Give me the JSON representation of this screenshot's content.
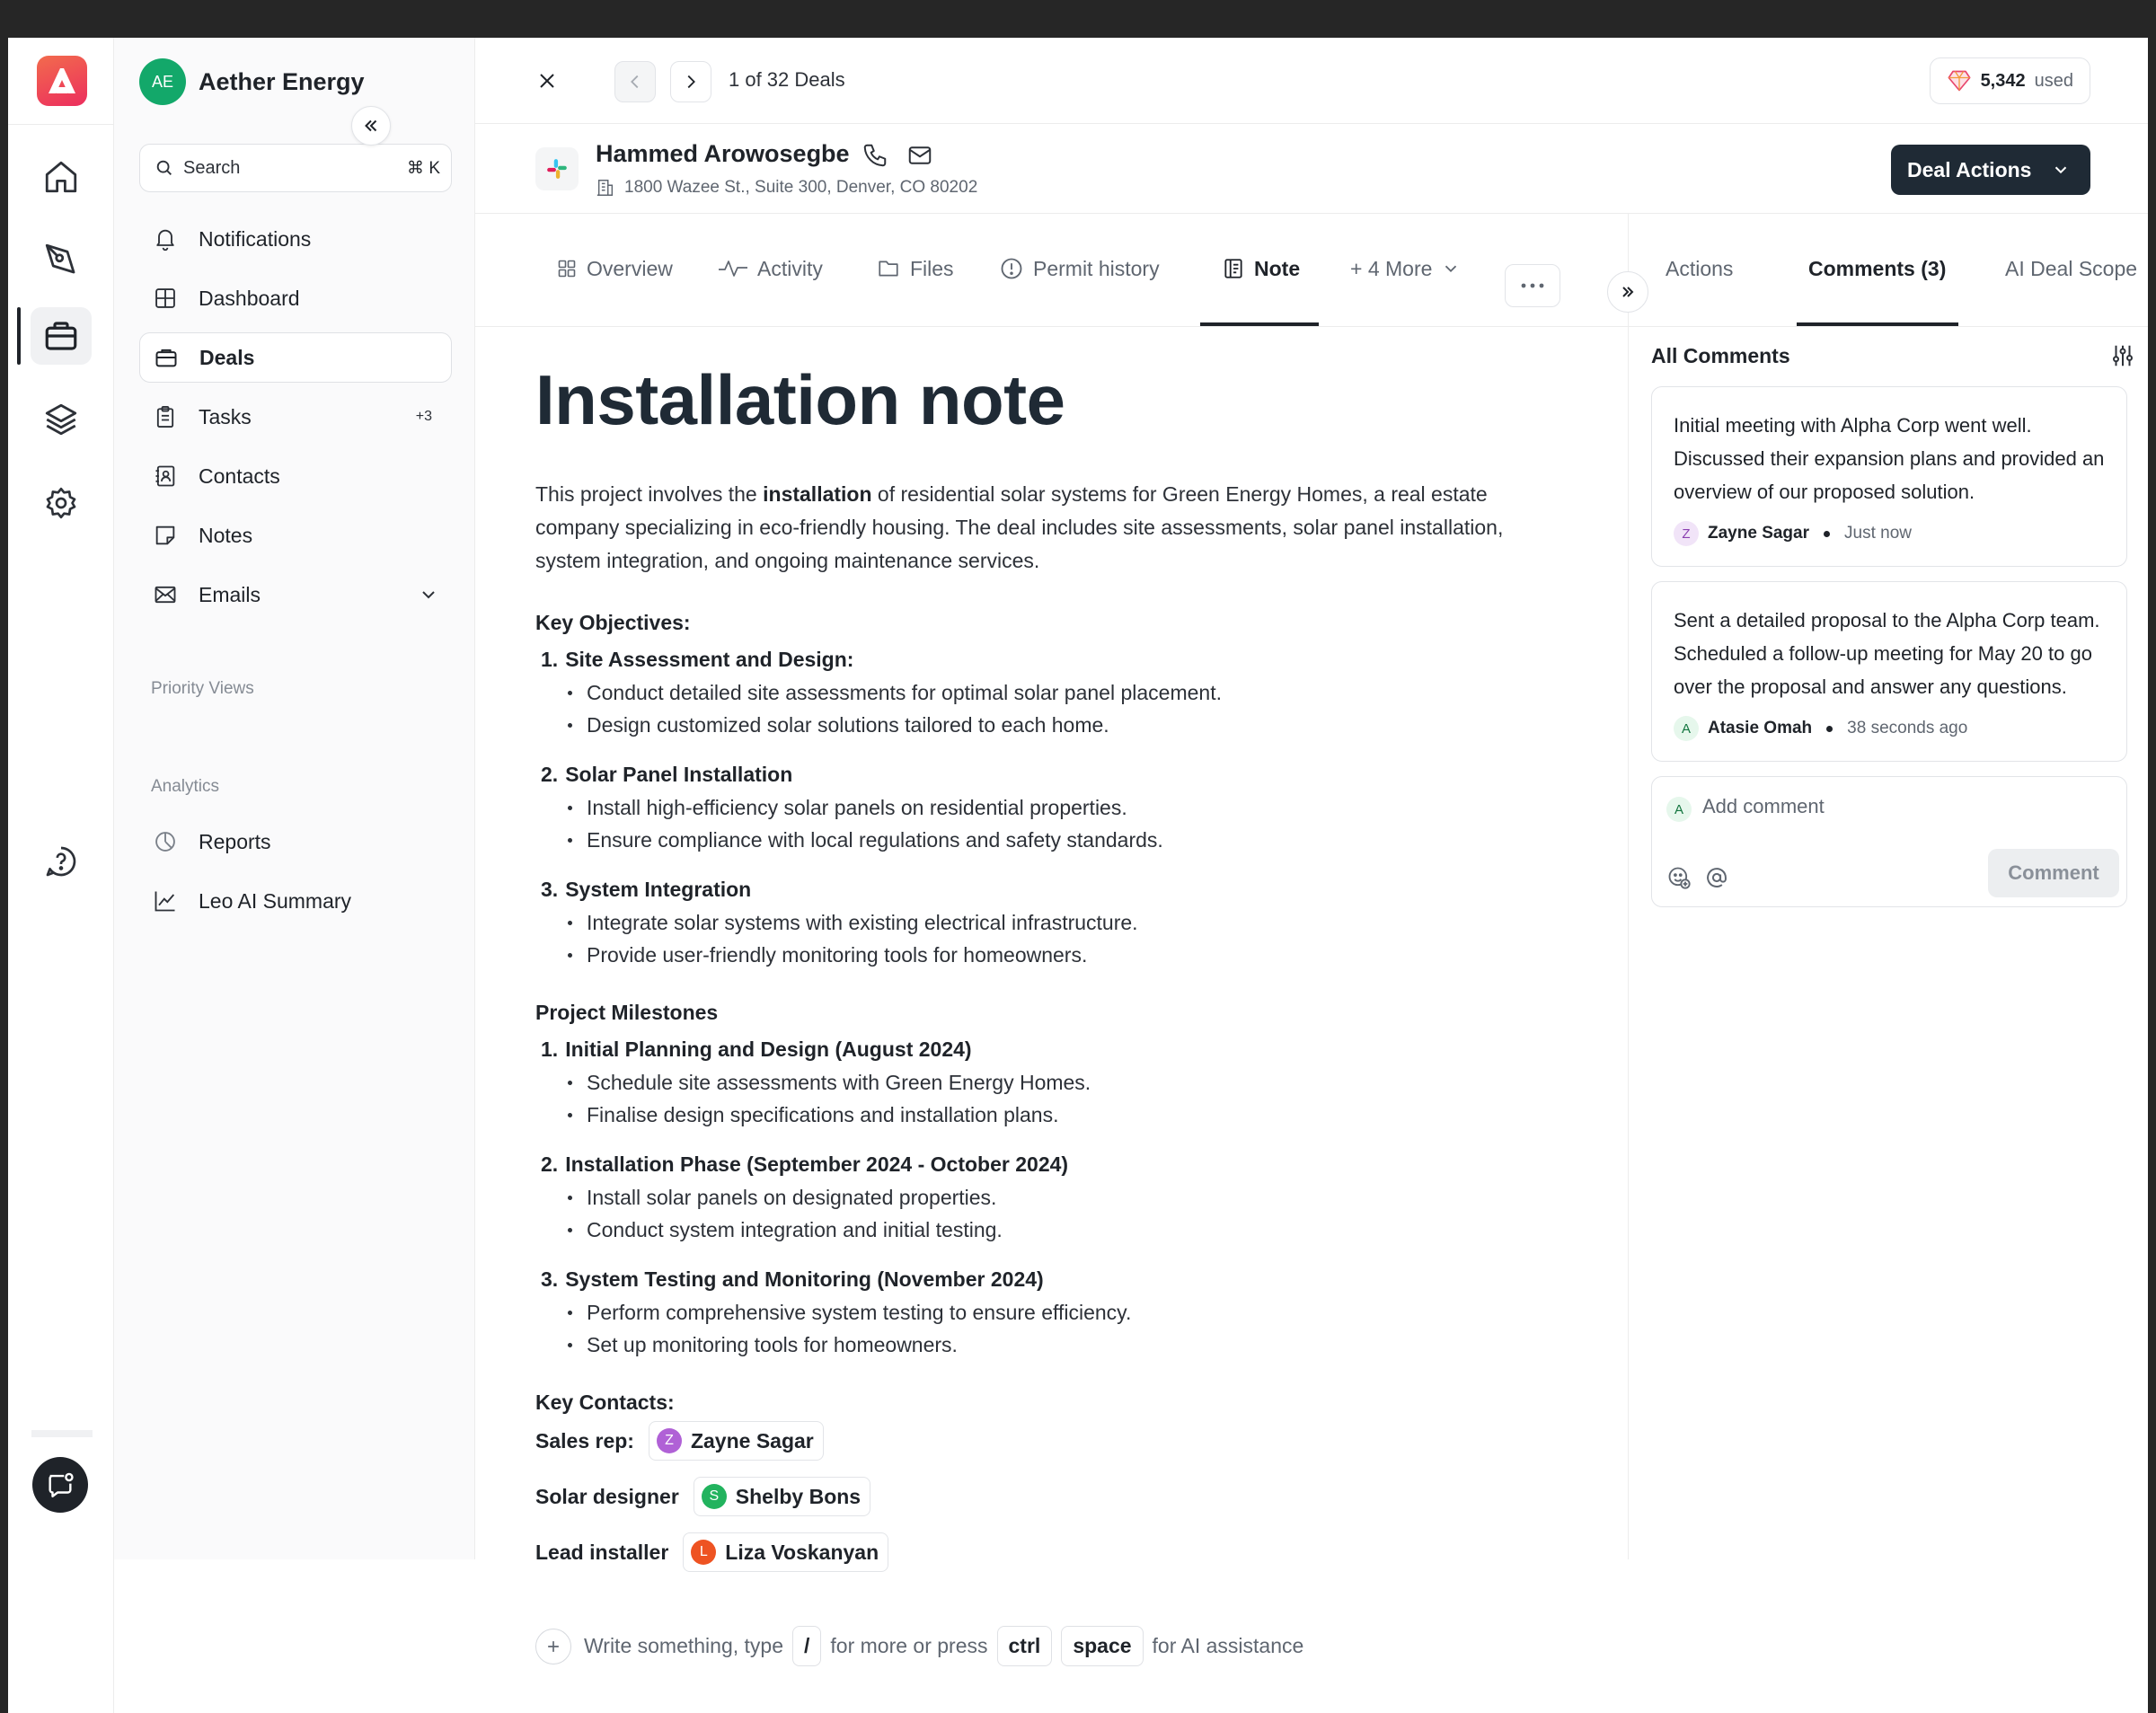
{
  "workspace": {
    "initials": "AE",
    "name": "Aether Energy"
  },
  "search": {
    "placeholder": "Search",
    "shortcut": "⌘ K"
  },
  "sidebar": {
    "items": [
      {
        "label": "Notifications",
        "icon": "bell-icon"
      },
      {
        "label": "Dashboard",
        "icon": "grid-icon"
      },
      {
        "label": "Deals",
        "icon": "briefcase-icon"
      },
      {
        "label": "Tasks",
        "icon": "clipboard-icon",
        "badge": "+3"
      },
      {
        "label": "Contacts",
        "icon": "contact-book-icon"
      },
      {
        "label": "Notes",
        "icon": "note-icon"
      },
      {
        "label": "Emails",
        "icon": "mail-icon"
      }
    ],
    "priority_label": "Priority Views",
    "analytics_label": "Analytics",
    "analytics_items": [
      {
        "label": "Reports",
        "icon": "pie-chart-icon"
      },
      {
        "label": "Leo AI Summary",
        "icon": "trend-line-icon"
      }
    ]
  },
  "topbar": {
    "pager_text": "1 of 32 Deals",
    "usage_value": "5,342",
    "usage_suffix": "used"
  },
  "contact": {
    "name": "Hammed Arowosegbe",
    "address": "1800 Wazee St., Suite 300, Denver, CO 80202",
    "deal_actions_label": "Deal Actions"
  },
  "tabs": {
    "overview": "Overview",
    "activity": "Activity",
    "files": "Files",
    "permit": "Permit history",
    "note": "Note",
    "more": "+ 4 More"
  },
  "right_tabs": {
    "actions": "Actions",
    "comments": "Comments (3)",
    "ai_scope": "AI Deal Scope"
  },
  "note": {
    "title": "Installation note",
    "intro_before": "This project involves the ",
    "intro_bold": "installation",
    "intro_after": " of residential solar systems for Green Energy Homes, a real estate company specializing in eco-friendly housing. The deal includes site assessments, solar panel installation, system integration, and ongoing maintenance services.",
    "objectives_heading": "Key Objectives:",
    "objectives": [
      {
        "num": "1.",
        "title": "Site Assessment and Design:",
        "bullets": [
          "Conduct detailed site assessments for optimal solar panel placement.",
          "Design customized solar solutions tailored to each home."
        ]
      },
      {
        "num": "2.",
        "title": "Solar Panel Installation",
        "bullets": [
          "Install high-efficiency solar panels on residential properties.",
          "Ensure compliance with local regulations and safety standards."
        ]
      },
      {
        "num": "3.",
        "title": "System Integration",
        "bullets": [
          "Integrate solar systems with existing electrical infrastructure.",
          "Provide user-friendly monitoring tools for homeowners."
        ]
      }
    ],
    "milestones_heading": "Project Milestones",
    "milestones": [
      {
        "num": "1.",
        "title": "Initial Planning and Design (August 2024)",
        "bullets": [
          "Schedule site assessments with Green Energy Homes.",
          "Finalise design specifications and installation plans."
        ]
      },
      {
        "num": "2.",
        "title": "Installation Phase (September 2024 - October 2024)",
        "bullets": [
          "Install solar panels on designated properties.",
          "Conduct system integration and initial testing."
        ]
      },
      {
        "num": "3.",
        "title": "System Testing and Monitoring (November 2024)",
        "bullets": [
          "Perform comprehensive system testing to ensure efficiency.",
          "Set up monitoring tools for homeowners."
        ]
      }
    ],
    "contacts_heading": "Key Contacts:",
    "contacts": [
      {
        "role": "Sales rep:",
        "initial": "Z",
        "name": "Zayne Sagar",
        "color": "#b061d6"
      },
      {
        "role": "Solar designer",
        "initial": "S",
        "name": "Shelby Bons",
        "color": "#22b35e"
      },
      {
        "role": "Lead installer",
        "initial": "L",
        "name": "Liza Voskanyan",
        "color": "#ee5322"
      }
    ]
  },
  "composer": {
    "text1": "Write something, type",
    "key_slash": "/",
    "text2": "for more or press",
    "key_ctrl": "ctrl",
    "key_space": "space",
    "text3": "for AI assistance"
  },
  "comments": {
    "heading": "All Comments",
    "items": [
      {
        "text": "Initial meeting with Alpha Corp went well. Discussed their expansion plans and provided an overview of our proposed solution.",
        "initial": "Z",
        "author": "Zayne Sagar",
        "time": "Just now"
      },
      {
        "text": "Sent a detailed proposal to the Alpha Corp team. Scheduled a follow-up meeting for May 20 to go over the proposal and answer any questions.",
        "initial": "A",
        "author": "Atasie Omah",
        "time": "38 seconds ago"
      }
    ],
    "add_initial": "A",
    "add_placeholder": "Add comment",
    "submit_label": "Comment"
  },
  "colors": {
    "accent_dark": "#1f2a35",
    "workspace_green": "#13a86a",
    "logo_gradient_start": "#f26b4d",
    "logo_gradient_end": "#ec2e5e"
  }
}
